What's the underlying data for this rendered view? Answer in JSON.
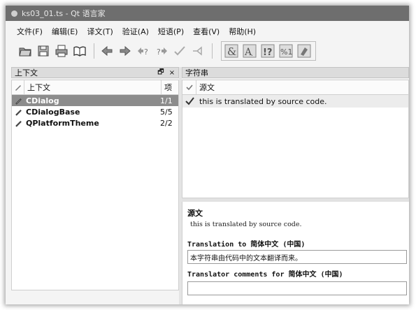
{
  "window": {
    "title": "ks03_01.ts - Qt 语言家"
  },
  "menubar": {
    "items": [
      {
        "label": "文件(F)"
      },
      {
        "label": "编辑(E)"
      },
      {
        "label": "译文(T)"
      },
      {
        "label": "验证(A)"
      },
      {
        "label": "短语(P)"
      },
      {
        "label": "查看(V)"
      },
      {
        "label": "帮助(H)"
      }
    ]
  },
  "toolbar": {
    "icons": [
      "open-icon",
      "save-icon",
      "print-icon",
      "phrasebook-icon",
      "prev-icon",
      "next-icon",
      "prev-unfinished-icon",
      "next-unfinished-icon",
      "done-next-icon",
      "copy-source-icon",
      "accelerator-icon",
      "punctuation-icon",
      "phrase-match-icon",
      "placeholder-icon",
      "surrounding-whitespace-icon"
    ]
  },
  "context_dock": {
    "title": "上下文",
    "float_button": "🗗",
    "close_button": "×",
    "columns": {
      "context": "上下文",
      "items": "项"
    },
    "rows": [
      {
        "name": "CDialog",
        "count": "1/1",
        "selected": true
      },
      {
        "name": "CDialogBase",
        "count": "5/5",
        "selected": false
      },
      {
        "name": "QPlatformTheme",
        "count": "2/2",
        "selected": false
      }
    ]
  },
  "strings_dock": {
    "title": "字符串",
    "columns": {
      "source": "源文"
    },
    "rows": [
      {
        "text": "this is translated by source code."
      }
    ]
  },
  "editor": {
    "source_heading": "源文",
    "source_text": "this is translated by source code.",
    "translation_label": "Translation to 简体中文 (中国)",
    "translation_value": "本字符串由代码中的文本翻译而来。",
    "comments_label": "Translator comments for 简体中文 (中国)",
    "comments_value": ""
  }
}
